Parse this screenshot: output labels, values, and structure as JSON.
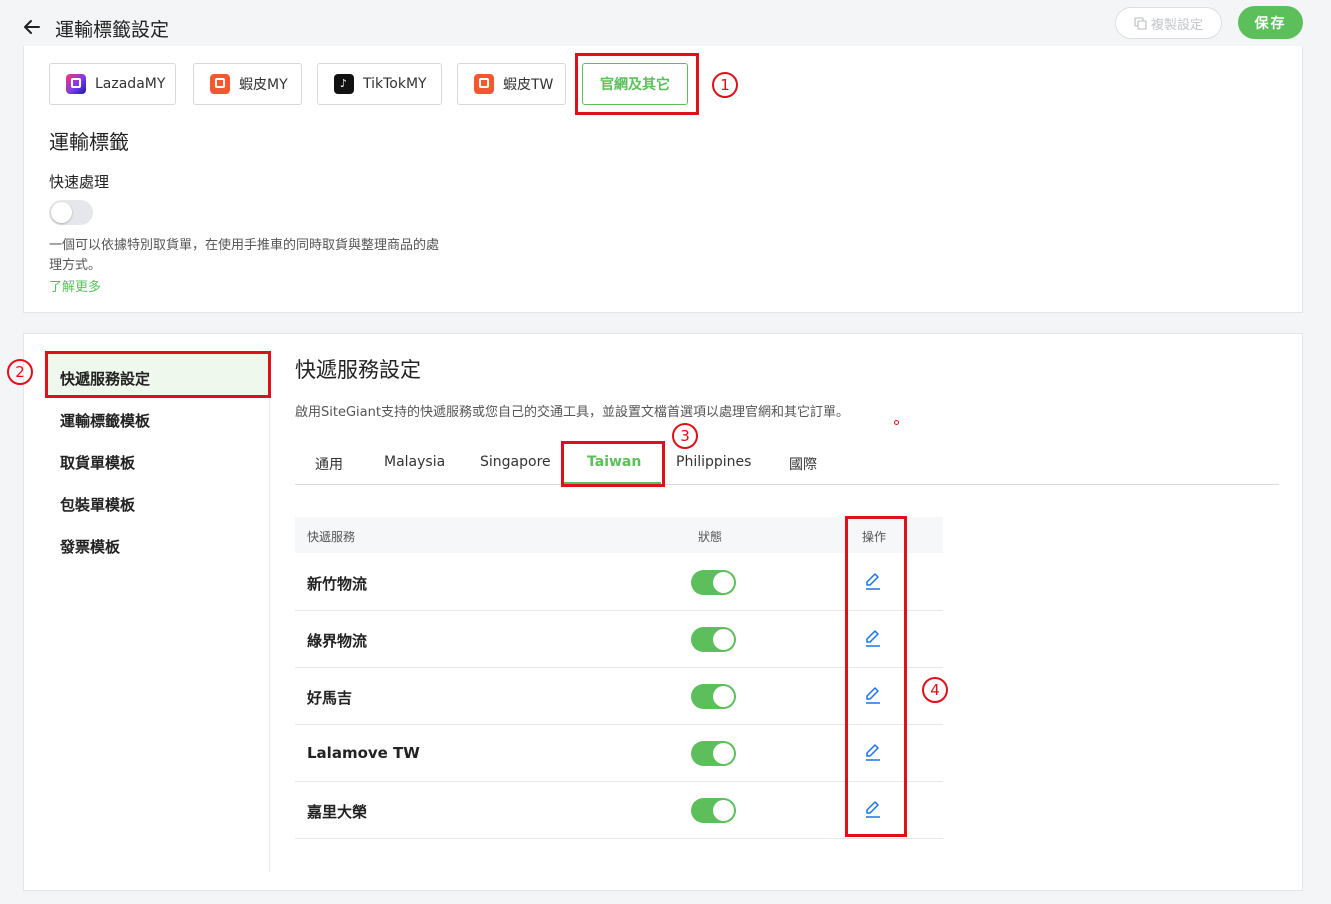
{
  "header": {
    "title": "運輸標籤設定",
    "copy_label": "複製設定",
    "save_label": "保存"
  },
  "platforms": [
    {
      "label": "LazadaMY",
      "icon": "lazada-icon"
    },
    {
      "label": "蝦皮MY",
      "icon": "shopee-icon"
    },
    {
      "label": "TikTokMY",
      "icon": "tiktok-icon"
    },
    {
      "label": "蝦皮TW",
      "icon": "shopee-icon"
    },
    {
      "label": "官網及其它",
      "active": true
    }
  ],
  "shipping_label": {
    "title": "運輸標籤",
    "quick_process_label": "快速處理",
    "quick_process_enabled": false,
    "description": "一個可以依據特別取貨單，在使用手推車的同時取貨與整理商品的處理方式。",
    "learn_more": "了解更多"
  },
  "sidebar": {
    "items": [
      {
        "label": "快遞服務設定",
        "active": true
      },
      {
        "label": "運輸標籤模板"
      },
      {
        "label": "取貨單模板"
      },
      {
        "label": "包裝單模板"
      },
      {
        "label": "發票模板"
      }
    ]
  },
  "courier": {
    "title": "快遞服務設定",
    "description": "啟用SiteGiant支持的快遞服務或您自己的交通工具，並設置文檔首選項以處理官網和其它訂單。",
    "tabs": [
      "通用",
      "Malaysia",
      "Singapore",
      "Taiwan",
      "Philippines",
      "國際"
    ],
    "active_tab": "Taiwan",
    "table": {
      "headers": [
        "快遞服務",
        "狀態",
        "操作"
      ],
      "rows": [
        {
          "name": "新竹物流",
          "enabled": true
        },
        {
          "name": "綠界物流",
          "enabled": true
        },
        {
          "name": "好馬吉",
          "enabled": true
        },
        {
          "name": "Lalamove TW",
          "enabled": true
        },
        {
          "name": "嘉里大榮",
          "enabled": true
        }
      ]
    }
  },
  "annotations": [
    "1",
    "2",
    "3",
    "4"
  ],
  "colors": {
    "accent": "#5cbf5c",
    "highlight": "#e0101a",
    "link": "#1a73e8"
  }
}
